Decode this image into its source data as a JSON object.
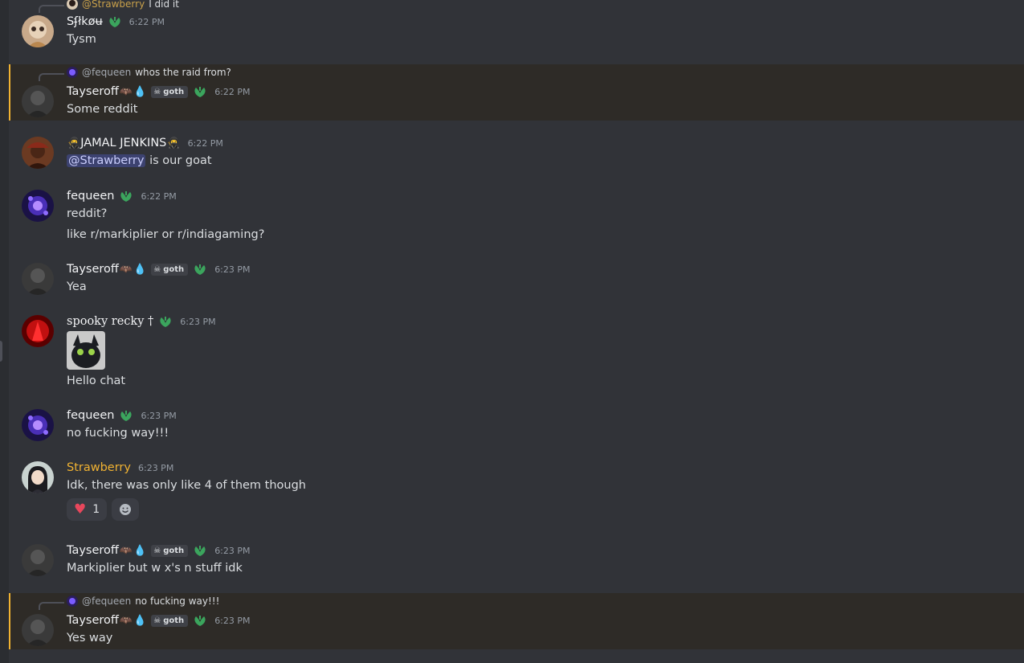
{
  "messages": [
    {
      "id": "m1",
      "reply": {
        "name": "@Strawberry",
        "text": "I did it",
        "gold": true
      },
      "author": "S̸̸̸",
      "author_text": "Sʄłkøʉ",
      "time": "6:22 PM",
      "lines": [
        "Tysm"
      ]
    },
    {
      "id": "m2",
      "reply": {
        "name": "@fequeen",
        "text": "whos the raid from?"
      },
      "author_text": "Tayseroff",
      "tag": "goth",
      "time": "6:22 PM",
      "lines": [
        "Some reddit"
      ]
    },
    {
      "id": "m3",
      "author_text": "JAMAL JENKINS",
      "time": "6:22 PM",
      "mention": "@Strawberry",
      "rest": " is our goat"
    },
    {
      "id": "m4",
      "author_text": "fequeen",
      "time": "6:22 PM",
      "lines": [
        "reddit?",
        "like r/markiplier or r/indiagaming?"
      ]
    },
    {
      "id": "m5",
      "author_text": "Tayseroff",
      "tag": "goth",
      "time": "6:23 PM",
      "lines": [
        "Yea"
      ]
    },
    {
      "id": "m6",
      "author_text": "spooky recky †",
      "time": "6:23 PM",
      "lines": [
        "Hello chat"
      ]
    },
    {
      "id": "m7",
      "author_text": "fequeen",
      "time": "6:23 PM",
      "lines": [
        "no fucking way!!!"
      ]
    },
    {
      "id": "m8",
      "author_text": "Strawberry",
      "time": "6:23 PM",
      "lines": [
        "Idk, there was only like 4 of them though"
      ],
      "reaction_count": "1"
    },
    {
      "id": "m9",
      "author_text": "Tayseroff",
      "tag": "goth",
      "time": "6:23 PM",
      "lines": [
        "Markiplier but w x's n stuff idk"
      ]
    },
    {
      "id": "m10",
      "reply": {
        "name": "@fequeen",
        "text": "no fucking way!!!"
      },
      "author_text": "Tayseroff",
      "tag": "goth",
      "time": "6:23 PM",
      "lines": [
        "Yes way"
      ]
    }
  ],
  "icons": {
    "badge": "leaf-badge-icon",
    "tag": "skull-icon",
    "reaction": "heart-icon",
    "add_reaction": "smiley-icon"
  },
  "colors": {
    "background": "#313338",
    "highlight": "#2e2b27",
    "accent": "#f0b232",
    "badge": "#3ba55d",
    "mention_bg": "#3c4270"
  }
}
